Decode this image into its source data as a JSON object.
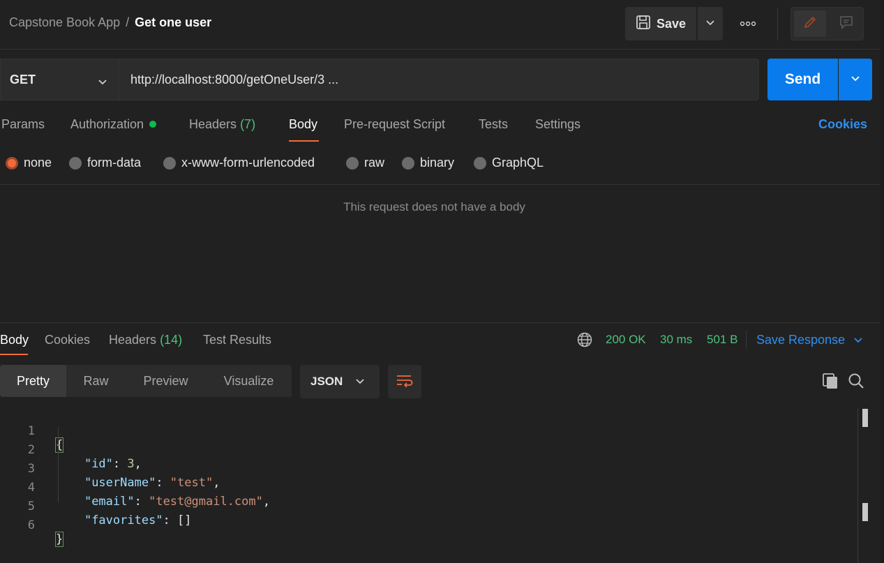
{
  "breadcrumb": {
    "collection": "Capstone Book App",
    "separator": "/",
    "request": "Get one user"
  },
  "toolbar": {
    "save_label": "Save"
  },
  "request": {
    "method": "GET",
    "url": "http://localhost:8000/getOneUser/3 ...",
    "send_label": "Send"
  },
  "request_tabs": {
    "params": "Params",
    "authorization": "Authorization",
    "headers": "Headers",
    "headers_count": "(7)",
    "body": "Body",
    "prerequest": "Pre-request Script",
    "tests": "Tests",
    "settings": "Settings",
    "cookies": "Cookies",
    "active": "Body"
  },
  "body_types": {
    "none": "none",
    "form_data": "form-data",
    "urlencoded": "x-www-form-urlencoded",
    "raw": "raw",
    "binary": "binary",
    "graphql": "GraphQL",
    "selected": "none"
  },
  "empty_body_message": "This request does not have a body",
  "response": {
    "tabs": {
      "body": "Body",
      "cookies": "Cookies",
      "headers": "Headers",
      "headers_count": "(14)",
      "test_results": "Test Results"
    },
    "status": "200 OK",
    "time": "30 ms",
    "size": "501 B",
    "save_response": "Save Response",
    "views": {
      "pretty": "Pretty",
      "raw": "Raw",
      "preview": "Preview",
      "visualize": "Visualize",
      "active": "Pretty"
    },
    "language": "JSON",
    "code_lines": [
      {
        "n": "1"
      },
      {
        "n": "2",
        "key": "\"id\"",
        "value": "3"
      },
      {
        "n": "3",
        "key": "\"userName\"",
        "value": "\"test\""
      },
      {
        "n": "4",
        "key": "\"email\"",
        "value": "\"test@gmail.com\""
      },
      {
        "n": "5",
        "key": "\"favorites\"",
        "value": "[]"
      },
      {
        "n": "6"
      }
    ],
    "open_brace": "{",
    "close_brace": "}"
  },
  "colors": {
    "accent_orange": "#f26b3a",
    "send_blue": "#097bed",
    "link_blue": "#2e8ff0",
    "status_green": "#4cc37a",
    "background": "#212121"
  },
  "icons": [
    "save-icon",
    "chevron-down-icon",
    "more-icon",
    "pencil-icon",
    "comment-icon",
    "globe-icon",
    "wrap-lines-icon",
    "copy-icon",
    "search-icon"
  ]
}
